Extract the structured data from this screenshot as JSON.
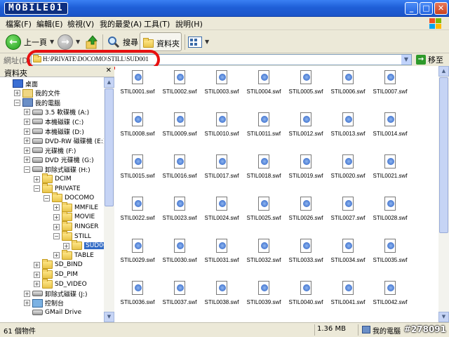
{
  "titlebar": {
    "logo": "MOBILE01",
    "minimize": "_",
    "maximize": "□",
    "close": "✕"
  },
  "menu": [
    "檔案(F)",
    "編輯(E)",
    "檢視(V)",
    "我的最愛(A)",
    "工具(T)",
    "說明(H)"
  ],
  "toolbar": {
    "back": "上一頁",
    "search": "搜尋",
    "folders": "資料夾"
  },
  "address": {
    "label": "網址(D)",
    "path": "H:\\PRIVATE\\DOCOMO\\STILL\\SUD001",
    "go": "移至"
  },
  "left_pane": {
    "title": "資料夾",
    "tree": [
      {
        "label": "桌面",
        "icon": "desktop-icon",
        "indent": 0,
        "expander": ""
      },
      {
        "label": "我的文件",
        "icon": "documents-icon",
        "indent": 1,
        "expander": "+"
      },
      {
        "label": "我的電腦",
        "icon": "computer-icon",
        "indent": 1,
        "expander": "−"
      },
      {
        "label": "3.5 軟碟機 (A:)",
        "icon": "drive-icon",
        "indent": 2,
        "expander": "+"
      },
      {
        "label": "本機磁碟 (C:)",
        "icon": "drive-icon",
        "indent": 2,
        "expander": "+"
      },
      {
        "label": "本機磁碟 (D:)",
        "icon": "drive-icon",
        "indent": 2,
        "expander": "+"
      },
      {
        "label": "DVD-RW 磁碟機 (E:)",
        "icon": "drive-icon",
        "indent": 2,
        "expander": "+"
      },
      {
        "label": "光碟機 (F:)",
        "icon": "drive-icon",
        "indent": 2,
        "expander": "+"
      },
      {
        "label": "DVD 光碟機 (G:)",
        "icon": "drive-icon",
        "indent": 2,
        "expander": "+"
      },
      {
        "label": "卸除式磁碟 (H:)",
        "icon": "drive-icon",
        "indent": 2,
        "expander": "−"
      },
      {
        "label": "DCIM",
        "icon": "folder-icon",
        "indent": 3,
        "expander": "+"
      },
      {
        "label": "PRIVATE",
        "icon": "folder-icon",
        "indent": 3,
        "expander": "−"
      },
      {
        "label": "DOCOMO",
        "icon": "folder-icon",
        "indent": 4,
        "expander": "−"
      },
      {
        "label": "MMFILE",
        "icon": "folder-icon",
        "indent": 5,
        "expander": "+"
      },
      {
        "label": "MOVIE",
        "icon": "folder-icon",
        "indent": 5,
        "expander": "+"
      },
      {
        "label": "RINGER",
        "icon": "folder-icon",
        "indent": 5,
        "expander": "+"
      },
      {
        "label": "STILL",
        "icon": "folder-icon",
        "indent": 5,
        "expander": "−"
      },
      {
        "label": "SUD001",
        "icon": "folder-open-icon",
        "indent": 6,
        "expander": "+",
        "selected": true
      },
      {
        "label": "TABLE",
        "icon": "folder-icon",
        "indent": 5,
        "expander": "+"
      },
      {
        "label": "SD_BIND",
        "icon": "folder-icon",
        "indent": 3,
        "expander": "+"
      },
      {
        "label": "SD_PIM",
        "icon": "folder-icon",
        "indent": 3,
        "expander": "+"
      },
      {
        "label": "SD_VIDEO",
        "icon": "folder-icon",
        "indent": 3,
        "expander": "+"
      },
      {
        "label": "卸除式磁碟 (J:)",
        "icon": "drive-icon",
        "indent": 2,
        "expander": "+"
      },
      {
        "label": "控制台",
        "icon": "control-panel-icon",
        "indent": 2,
        "expander": "+"
      },
      {
        "label": "GMail Drive",
        "icon": "drive-icon",
        "indent": 2,
        "expander": ""
      }
    ]
  },
  "files": [
    "STIL0001.swf",
    "STIL0002.swf",
    "STIL0003.swf",
    "STIL0004.swf",
    "STIL0005.swf",
    "STIL0006.swf",
    "STIL0007.swf",
    "STIL0008.swf",
    "STIL0009.swf",
    "STIL0010.swf",
    "STIL0011.swf",
    "STIL0012.swf",
    "STIL0013.swf",
    "STIL0014.swf",
    "STIL0015.swf",
    "STIL0016.swf",
    "STIL0017.swf",
    "STIL0018.swf",
    "STIL0019.swf",
    "STIL0020.swf",
    "STIL0021.swf",
    "STIL0022.swf",
    "STIL0023.swf",
    "STIL0024.swf",
    "STIL0025.swf",
    "STIL0026.swf",
    "STIL0027.swf",
    "STIL0028.swf",
    "STIL0029.swf",
    "STIL0030.swf",
    "STIL0031.swf",
    "STIL0032.swf",
    "STIL0033.swf",
    "STIL0034.swf",
    "STIL0035.swf",
    "STIL0036.swf",
    "STIL0037.swf",
    "STIL0038.swf",
    "STIL0039.swf",
    "STIL0040.swf",
    "STIL0041.swf",
    "STIL0042.swf"
  ],
  "status": {
    "count": "61 個物件",
    "size": "1.36 MB",
    "location": "我的電腦",
    "watermark": "#278091"
  },
  "colors": {
    "title_bar": "#1f5fd8",
    "highlight_ring": "#e81010",
    "selection": "#316ac5"
  }
}
